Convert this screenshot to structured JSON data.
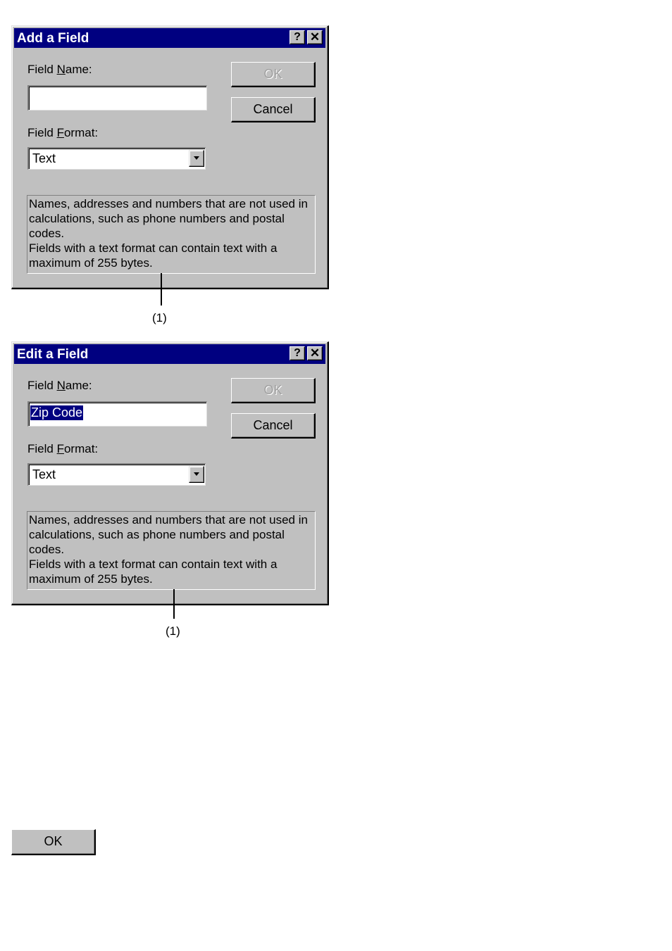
{
  "dialogs": [
    {
      "title": "Add a Field",
      "help_icon": "?",
      "close_icon": "✕",
      "field_name_label_pre": "Field ",
      "field_name_label_key": "N",
      "field_name_label_post": "ame:",
      "field_name_value": "",
      "field_name_selected": false,
      "field_format_label_pre": "Field ",
      "field_format_label_key": "F",
      "field_format_label_post": "ormat:",
      "field_format_value": "Text",
      "ok_label": "OK",
      "ok_disabled": true,
      "cancel_label": "Cancel",
      "description_lines": [
        "Names, addresses and numbers that are not used in calculations, such as phone numbers and postal codes.",
        "Fields with a text format can contain text with a maximum of 255 bytes."
      ],
      "callout": "(1)"
    },
    {
      "title": "Edit a Field",
      "help_icon": "?",
      "close_icon": "✕",
      "field_name_label_pre": "Field ",
      "field_name_label_key": "N",
      "field_name_label_post": "ame:",
      "field_name_value": "Zip Code",
      "field_name_selected": true,
      "field_format_label_pre": "Field ",
      "field_format_label_key": "F",
      "field_format_label_post": "ormat:",
      "field_format_value": "Text",
      "ok_label": "OK",
      "ok_disabled": true,
      "cancel_label": "Cancel",
      "description_lines": [
        "Names, addresses and numbers that are not used in calculations, such as phone numbers and postal codes.",
        "Fields with a text format can contain text with a maximum of 255 bytes."
      ],
      "callout": "(1)"
    }
  ],
  "standalone_button": {
    "label": "OK"
  }
}
